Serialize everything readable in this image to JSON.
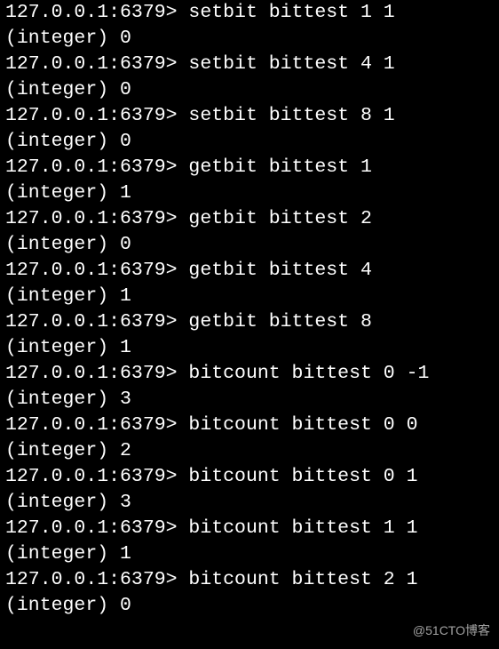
{
  "prompt": "127.0.0.1:6379>",
  "lines": [
    {
      "type": "cmd",
      "text": "setbit bittest 1 1"
    },
    {
      "type": "out",
      "text": "(integer) 0"
    },
    {
      "type": "cmd",
      "text": "setbit bittest 4 1"
    },
    {
      "type": "out",
      "text": "(integer) 0"
    },
    {
      "type": "cmd",
      "text": "setbit bittest 8 1"
    },
    {
      "type": "out",
      "text": "(integer) 0"
    },
    {
      "type": "cmd",
      "text": "getbit bittest 1"
    },
    {
      "type": "out",
      "text": "(integer) 1"
    },
    {
      "type": "cmd",
      "text": "getbit bittest 2"
    },
    {
      "type": "out",
      "text": "(integer) 0"
    },
    {
      "type": "cmd",
      "text": "getbit bittest 4"
    },
    {
      "type": "out",
      "text": "(integer) 1"
    },
    {
      "type": "cmd",
      "text": "getbit bittest 8"
    },
    {
      "type": "out",
      "text": "(integer) 1"
    },
    {
      "type": "cmd",
      "text": "bitcount bittest 0 -1"
    },
    {
      "type": "out",
      "text": "(integer) 3"
    },
    {
      "type": "cmd",
      "text": "bitcount bittest 0 0"
    },
    {
      "type": "out",
      "text": "(integer) 2"
    },
    {
      "type": "cmd",
      "text": "bitcount bittest 0 1"
    },
    {
      "type": "out",
      "text": "(integer) 3"
    },
    {
      "type": "cmd",
      "text": "bitcount bittest 1 1"
    },
    {
      "type": "out",
      "text": "(integer) 1"
    },
    {
      "type": "cmd",
      "text": "bitcount bittest 2 1"
    },
    {
      "type": "out",
      "text": "(integer) 0"
    }
  ],
  "watermark": "@51CTO博客"
}
